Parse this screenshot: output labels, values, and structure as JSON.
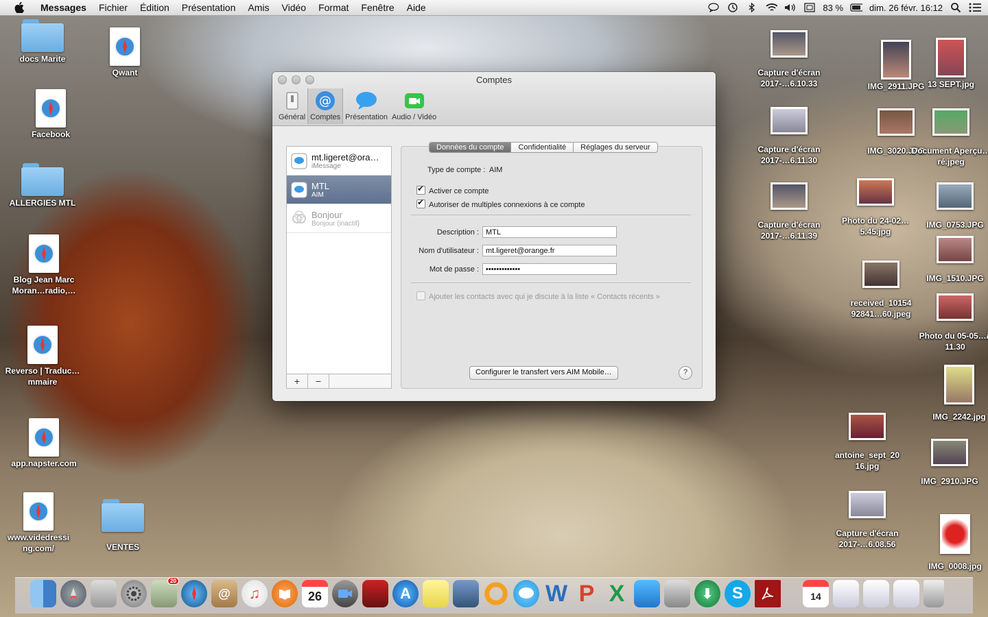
{
  "menubar": {
    "app": "Messages",
    "items": [
      "Fichier",
      "Édition",
      "Présentation",
      "Amis",
      "Vidéo",
      "Format",
      "Fenêtre",
      "Aide"
    ],
    "battery": "83 %",
    "datetime": "dim. 26 févr. 16:12"
  },
  "desktop_left": [
    {
      "label": "docs Marite",
      "kind": "folder"
    },
    {
      "label": "Qwant",
      "kind": "webloc"
    },
    {
      "label": "Facebook",
      "kind": "webloc"
    },
    {
      "label": "ALLERGIES MTL",
      "kind": "folder"
    },
    {
      "label": "Blog Jean Marc Moran…radio,…",
      "kind": "webloc"
    },
    {
      "label": "Reverso | Traduc…mmaire",
      "kind": "webloc"
    },
    {
      "label": "app.napster.com",
      "kind": "webloc"
    },
    {
      "label": "www.videdressi ng.com/",
      "kind": "webloc"
    },
    {
      "label": "VENTES",
      "kind": "folder"
    }
  ],
  "desktop_right": [
    {
      "label": "Capture d'écran 2017-…6.10.33"
    },
    {
      "label": "IMG_2911.JPG"
    },
    {
      "label": "13 SEPT.jpg"
    },
    {
      "label": "Capture d'écran 2017-…6.11.30"
    },
    {
      "label": "IMG_3020.JPG"
    },
    {
      "label": "Document Aperçu…ré.jpeg"
    },
    {
      "label": "Capture d'écran 2017-…6.11.39"
    },
    {
      "label": "Photo du 24-02…5.45.jpg"
    },
    {
      "label": "IMG_0753.JPG"
    },
    {
      "label": "received_10154 92841…60.jpeg"
    },
    {
      "label": "IMG_1510.JPG"
    },
    {
      "label": "Photo du 05-05…à 11.30"
    },
    {
      "label": "IMG_2242.jpg"
    },
    {
      "label": "antoine_sept_20 16.jpg"
    },
    {
      "label": "IMG_2910.JPG"
    },
    {
      "label": "Capture d'écran 2017-…6.08.56"
    },
    {
      "label": "IMG_0008.jpg"
    }
  ],
  "window": {
    "title": "Comptes",
    "toolbar": [
      "Général",
      "Comptes",
      "Présentation",
      "Audio / Vidéo"
    ],
    "accounts": [
      {
        "name": "mt.ligeret@ora…",
        "type": "iMessage"
      },
      {
        "name": "MTL",
        "type": "AIM"
      },
      {
        "name": "Bonjour",
        "type": "Bonjour (inactif)"
      }
    ],
    "list_add": "+",
    "list_remove": "−",
    "tabs": [
      "Données du compte",
      "Confidentialité",
      "Réglages du serveur"
    ],
    "account_type_label": "Type de compte :",
    "account_type_value": "AIM",
    "enable_label": "Activer ce compte",
    "multi_label": "Autoriser de multiples connexions à ce compte",
    "description_label": "Description :",
    "description_value": "MTL",
    "username_label": "Nom d'utilisateur :",
    "username_value": "mt.ligeret@orange.fr",
    "password_label": "Mot de passe :",
    "password_value": "•••••••••••••",
    "recent_label": "Ajouter les contacts avec qui je discute à la liste « Contacts récents »",
    "transfer_button": "Configurer le transfert vers AIM Mobile…",
    "help": "?"
  },
  "dock": {
    "calendar_day": "26",
    "calendar2_day": "14",
    "mail_badge": "20"
  }
}
